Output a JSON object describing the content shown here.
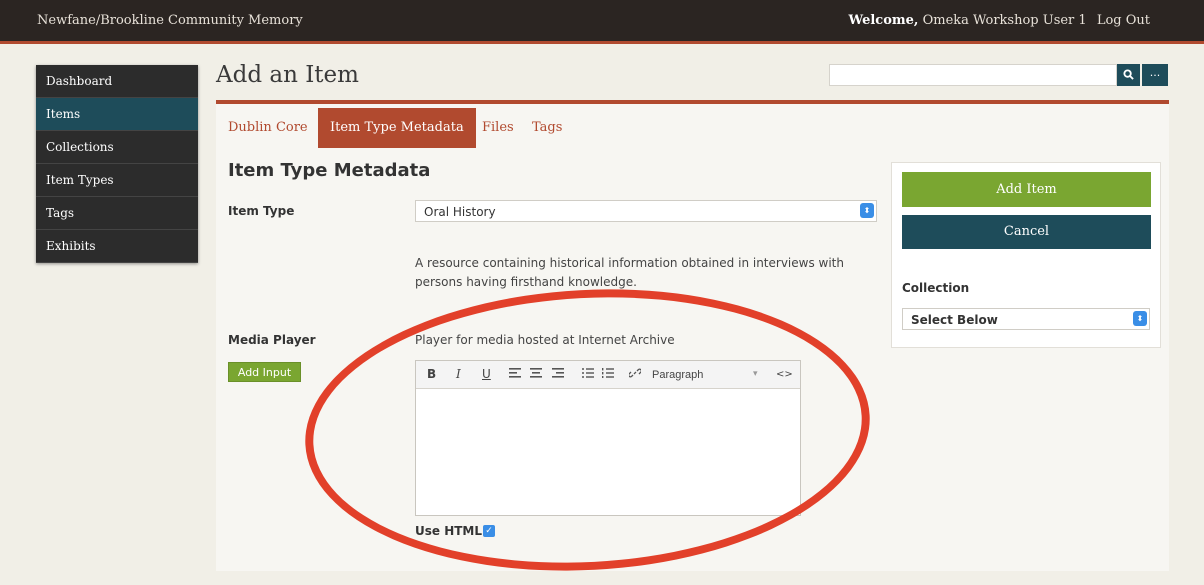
{
  "header": {
    "site_title": "Newfane/Brookline Community Memory",
    "welcome_label": "Welcome,",
    "user_name": "Omeka Workshop User 1",
    "logout_label": "Log Out"
  },
  "sidebar": {
    "items": [
      {
        "label": "Dashboard"
      },
      {
        "label": "Items"
      },
      {
        "label": "Collections"
      },
      {
        "label": "Item Types"
      },
      {
        "label": "Tags"
      },
      {
        "label": "Exhibits"
      }
    ]
  },
  "page": {
    "title": "Add an Item"
  },
  "search": {
    "placeholder": "",
    "advanced_label": "..."
  },
  "tabs": [
    {
      "label": "Dublin Core"
    },
    {
      "label": "Item Type Metadata"
    },
    {
      "label": "Files"
    },
    {
      "label": "Tags"
    }
  ],
  "form": {
    "section_title": "Item Type Metadata",
    "item_type_label": "Item Type",
    "item_type_value": "Oral History",
    "item_type_description": "A resource containing historical information obtained in interviews with persons having firsthand knowledge.",
    "media_player_label": "Media Player",
    "media_player_description": "Player for media hosted at Internet Archive",
    "add_input_label": "Add Input",
    "editor_toolbar": {
      "bold": "B",
      "italic": "I",
      "underline": "U",
      "format_label": "Paragraph",
      "format_caret": "▾",
      "code": "<>"
    },
    "use_html_label": "Use HTML",
    "use_html_checked": true
  },
  "side_panel": {
    "add_item_label": "Add Item",
    "cancel_label": "Cancel",
    "collection_label": "Collection",
    "collection_value": "Select Below"
  },
  "colors": {
    "accent": "#b14a2f",
    "nav_dark": "#2c2c2c",
    "teal": "#1e4c5a",
    "green": "#7aa631",
    "annotation_red": "#e2402a"
  }
}
